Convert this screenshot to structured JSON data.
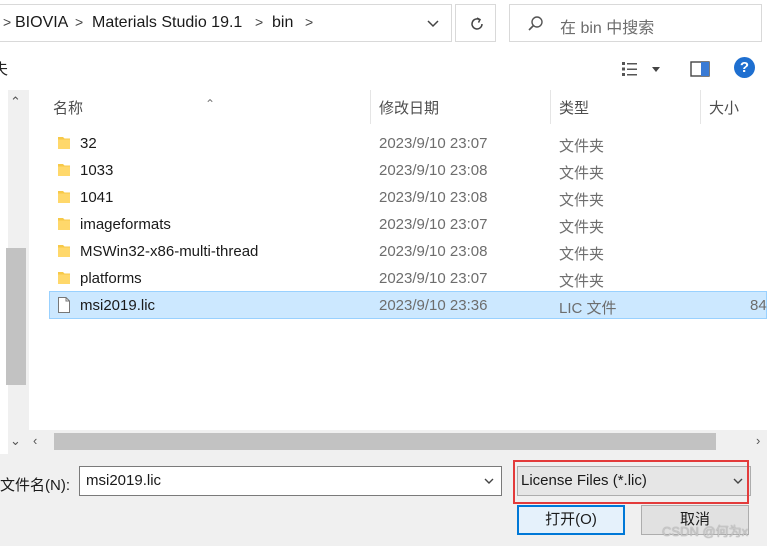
{
  "breadcrumb": {
    "items": [
      "BIOVIA",
      "Materials Studio 19.1",
      "bin"
    ],
    "separator": ">"
  },
  "search": {
    "placeholder": "在 bin 中搜索"
  },
  "toolbar": {
    "partial_label": "夫",
    "help_label": "?"
  },
  "columns": {
    "name": "名称",
    "date": "修改日期",
    "type": "类型",
    "size": "大小"
  },
  "files": [
    {
      "name": "32",
      "date": "2023/9/10 23:07",
      "type": "文件夹",
      "size": "",
      "kind": "folder",
      "selected": false
    },
    {
      "name": "1033",
      "date": "2023/9/10 23:08",
      "type": "文件夹",
      "size": "",
      "kind": "folder",
      "selected": false
    },
    {
      "name": "1041",
      "date": "2023/9/10 23:08",
      "type": "文件夹",
      "size": "",
      "kind": "folder",
      "selected": false
    },
    {
      "name": "imageformats",
      "date": "2023/9/10 23:07",
      "type": "文件夹",
      "size": "",
      "kind": "folder",
      "selected": false
    },
    {
      "name": "MSWin32-x86-multi-thread",
      "date": "2023/9/10 23:08",
      "type": "文件夹",
      "size": "",
      "kind": "folder",
      "selected": false
    },
    {
      "name": "platforms",
      "date": "2023/9/10 23:07",
      "type": "文件夹",
      "size": "",
      "kind": "folder",
      "selected": false
    },
    {
      "name": "msi2019.lic",
      "date": "2023/9/10 23:36",
      "type": "LIC 文件",
      "size": "84",
      "kind": "file",
      "selected": true
    }
  ],
  "footer": {
    "filename_label": "文件名(N):",
    "filename_value": "msi2019.lic",
    "filter_value": "License Files (*.lic)",
    "open_label": "打开(O)",
    "cancel_label": "取消",
    "watermark": "CSDN @何为x"
  },
  "colors": {
    "folder": "#f7c948",
    "selection_bg": "#cce8ff",
    "selection_border": "#99d1ff",
    "highlight_box": "#e33b3b",
    "primary_border": "#0078d7"
  }
}
